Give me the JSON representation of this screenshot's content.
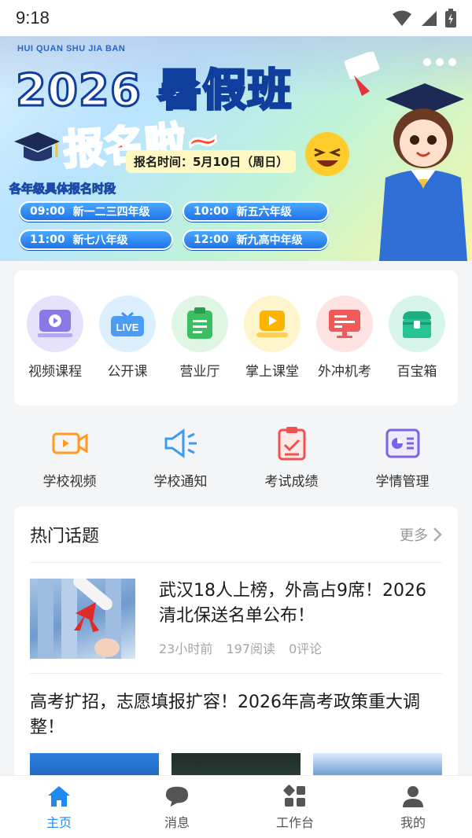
{
  "status": {
    "time": "9:18"
  },
  "banner": {
    "pinyin": "HUI QUAN SHU JIA BAN",
    "title": "2026 暑假班",
    "subtitle": "报名啦~",
    "reg_time": "报名时间：5月10日（周日）",
    "grade_heading": "各年级具体报名时段",
    "slots": [
      {
        "time": "09:00",
        "grades": "新一二三四年级"
      },
      {
        "time": "10:00",
        "grades": "新五六年级"
      },
      {
        "time": "11:00",
        "grades": "新七八年级"
      },
      {
        "time": "12:00",
        "grades": "新九高中年级"
      }
    ]
  },
  "quick_menu": [
    {
      "label": "视频课程",
      "icon": "video-course-icon",
      "bg": "#e6e2fb"
    },
    {
      "label": "公开课",
      "icon": "live-icon",
      "bg": "#dcefff"
    },
    {
      "label": "营业厅",
      "icon": "clipboard-icon",
      "bg": "#dff6e4"
    },
    {
      "label": "掌上课堂",
      "icon": "play-icon",
      "bg": "#fff5cc"
    },
    {
      "label": "外冲机考",
      "icon": "monitor-icon",
      "bg": "#ffe3e3"
    },
    {
      "label": "百宝箱",
      "icon": "treasure-box-icon",
      "bg": "#d8f5ec"
    }
  ],
  "school_menu": [
    {
      "label": "学校视频",
      "icon": "video-camera-icon"
    },
    {
      "label": "学校通知",
      "icon": "megaphone-icon"
    },
    {
      "label": "考试成绩",
      "icon": "score-report-icon"
    },
    {
      "label": "学情管理",
      "icon": "analytics-icon"
    }
  ],
  "topics": {
    "title": "热门话题",
    "more": "更多",
    "articles": [
      {
        "title": "武汉18人上榜，外高占9席！2026清北保送名单公布！",
        "time": "23小时前",
        "reads": "197阅读",
        "comments": "0评论"
      },
      {
        "title": "高考扩招，志愿填报扩容！2026年高考政策重大调整！"
      }
    ]
  },
  "bottom_nav": [
    {
      "label": "主页",
      "icon": "home-icon",
      "active": true
    },
    {
      "label": "消息",
      "icon": "chat-icon",
      "active": false
    },
    {
      "label": "工作台",
      "icon": "grid-icon",
      "active": false
    },
    {
      "label": "我的",
      "icon": "user-icon",
      "active": false
    }
  ],
  "colors": {
    "accent": "#1e8af0",
    "background": "#f4f5f7"
  }
}
